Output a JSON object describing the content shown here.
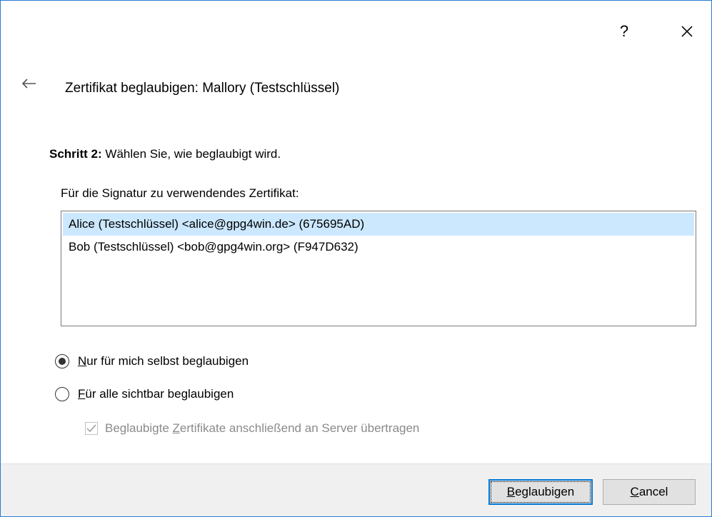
{
  "titlebar": {
    "help_label": "?",
    "close_icon": "close-icon"
  },
  "header": {
    "back_icon": "back-arrow-icon",
    "title": "Zertifikat beglaubigen: Mallory (Testschlüssel)"
  },
  "step": {
    "label": "Schritt 2:",
    "text": " Wählen Sie, wie beglaubigt wird."
  },
  "cert_list": {
    "label": "Für die Signatur zu verwendendes Zertifikat:",
    "items": [
      {
        "text": "Alice (Testschlüssel) <alice@gpg4win.de> (675695AD)",
        "selected": true
      },
      {
        "text": "Bob (Testschlüssel) <bob@gpg4win.org> (F947D632)",
        "selected": false
      }
    ]
  },
  "options": {
    "local_first": "N",
    "local_rest": "ur für mich selbst beglaubigen",
    "local_checked": true,
    "public_first": "F",
    "public_rest": "ür alle sichtbar beglaubigen",
    "public_checked": false,
    "upload_pre": "Beglaubigte ",
    "upload_accel": "Z",
    "upload_post": "ertifikate anschließend an Server übertragen",
    "upload_checked": true,
    "upload_disabled": true
  },
  "footer": {
    "certify_first": "B",
    "certify_rest": "eglaubigen",
    "cancel_first": "C",
    "cancel_rest": "ancel"
  },
  "colors": {
    "selection": "#cce8ff",
    "accent": "#0078d7",
    "footer_bg": "#f0f0f0"
  }
}
